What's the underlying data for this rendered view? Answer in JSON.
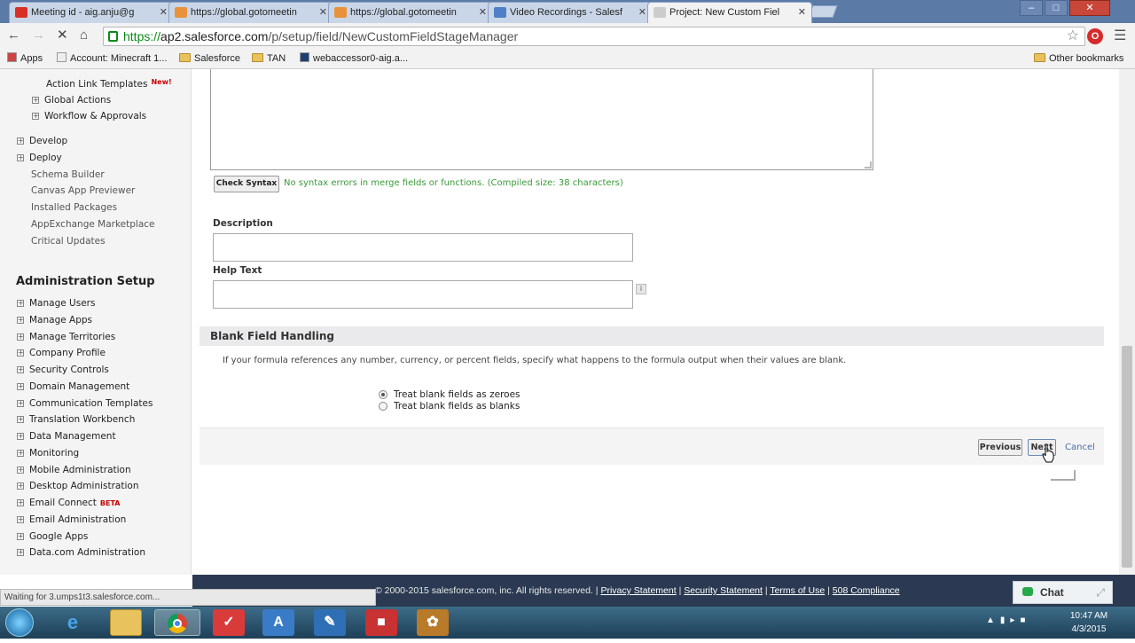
{
  "browser": {
    "tabs": [
      {
        "title": "Meeting id - aig.anju@g",
        "favicon": "gmail-icon",
        "active": false
      },
      {
        "title": "https://global.gotomeetin",
        "favicon": "gotomeeting-icon",
        "active": false
      },
      {
        "title": "https://global.gotomeetin",
        "favicon": "gotomeeting-icon",
        "active": false
      },
      {
        "title": "Video Recordings - Salesf",
        "favicon": "salesforce-icon",
        "active": false
      },
      {
        "title": "Project: New Custom Fiel",
        "favicon": "loading-icon",
        "active": true
      }
    ],
    "url_scheme": "https://",
    "url_host": "ap2.salesforce.com",
    "url_path": "/p/setup/field/NewCustomFieldStageManager",
    "bookmarks": [
      {
        "label": "Apps",
        "icon": "apps-grid-icon"
      },
      {
        "label": "Account: Minecraft 1...",
        "icon": "page-icon"
      },
      {
        "label": "Salesforce",
        "icon": "folder-icon"
      },
      {
        "label": "TAN",
        "icon": "folder-icon"
      },
      {
        "label": "webaccessor0-aig.a...",
        "icon": "k-icon"
      }
    ],
    "other_bookmarks": "Other bookmarks"
  },
  "sidebar": {
    "top_items": [
      {
        "label": "Action Link Templates",
        "badge": "New!",
        "expandable": false
      },
      {
        "label": "Global Actions",
        "expandable": true
      },
      {
        "label": "Workflow & Approvals",
        "expandable": true
      }
    ],
    "build_items": [
      {
        "label": "Develop",
        "expandable": true
      },
      {
        "label": "Deploy",
        "expandable": true
      },
      {
        "label": "Schema Builder",
        "expandable": false
      },
      {
        "label": "Canvas App Previewer",
        "expandable": false
      },
      {
        "label": "Installed Packages",
        "expandable": false
      },
      {
        "label": "AppExchange Marketplace",
        "expandable": false
      },
      {
        "label": "Critical Updates",
        "expandable": false
      }
    ],
    "admin_header": "Administration Setup",
    "admin_items": [
      {
        "label": "Manage Users"
      },
      {
        "label": "Manage Apps"
      },
      {
        "label": "Manage Territories"
      },
      {
        "label": "Company Profile"
      },
      {
        "label": "Security Controls"
      },
      {
        "label": "Domain Management"
      },
      {
        "label": "Communication Templates"
      },
      {
        "label": "Translation Workbench"
      },
      {
        "label": "Data Management"
      },
      {
        "label": "Monitoring"
      },
      {
        "label": "Mobile Administration"
      },
      {
        "label": "Desktop Administration"
      },
      {
        "label": "Email Connect",
        "badge": "BETA"
      },
      {
        "label": "Email Administration"
      },
      {
        "label": "Google Apps"
      },
      {
        "label": "Data.com Administration"
      }
    ]
  },
  "form": {
    "check_syntax": "Check Syntax",
    "syntax_message": "No syntax errors in merge fields or functions. (Compiled size: 38 characters)",
    "description_label": "Description",
    "description_value": "",
    "help_text_label": "Help Text",
    "help_text_value": "",
    "help_icon": "i",
    "blank_section_title": "Blank Field Handling",
    "blank_section_desc": "If your formula references any number, currency, or percent fields, specify what happens to the formula output when their values are blank.",
    "options": [
      {
        "label": "Treat blank fields as zeroes",
        "selected": true
      },
      {
        "label": "Treat blank fields as blanks",
        "selected": false
      }
    ],
    "previous": "Previous",
    "next": "Next",
    "cancel": "Cancel"
  },
  "footer": {
    "copyright": "© 2000-2015 salesforce.com, inc. All rights reserved.",
    "links": [
      "Privacy Statement",
      "Security Statement",
      "Terms of Use",
      "508 Compliance"
    ]
  },
  "status_text": "Waiting for 3.umps1t3.salesforce.com...",
  "chat": {
    "label": "Chat"
  },
  "taskbar": {
    "time": "10:47 AM",
    "date": "4/3/2015"
  },
  "colors": {
    "window_frame": "#5b7aa6",
    "footer_bg": "#2b3a52",
    "success_text": "#3a9a3a",
    "link": "#4a6fa5"
  }
}
